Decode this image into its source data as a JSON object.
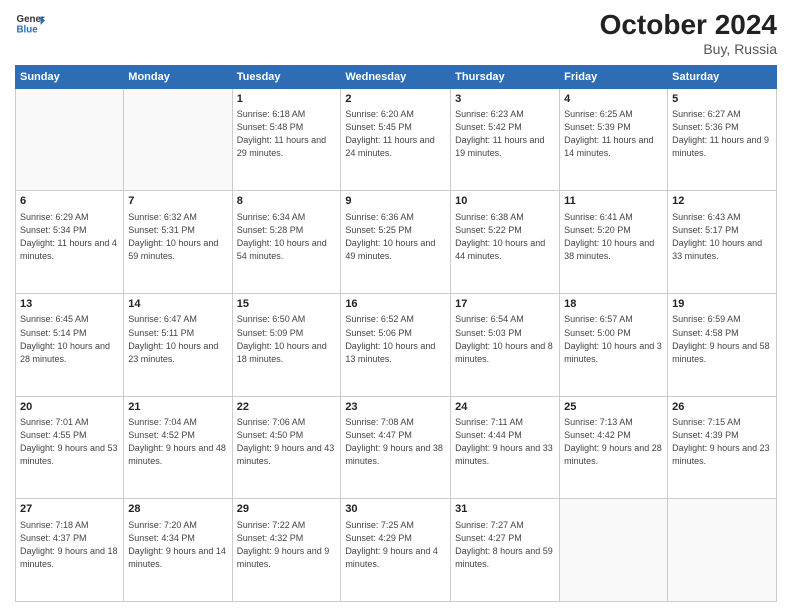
{
  "logo": {
    "line1": "General",
    "line2": "Blue"
  },
  "title": "October 2024",
  "location": "Buy, Russia",
  "days_header": [
    "Sunday",
    "Monday",
    "Tuesday",
    "Wednesday",
    "Thursday",
    "Friday",
    "Saturday"
  ],
  "weeks": [
    [
      {
        "day": "",
        "content": ""
      },
      {
        "day": "",
        "content": ""
      },
      {
        "day": "1",
        "content": "Sunrise: 6:18 AM\nSunset: 5:48 PM\nDaylight: 11 hours\nand 29 minutes."
      },
      {
        "day": "2",
        "content": "Sunrise: 6:20 AM\nSunset: 5:45 PM\nDaylight: 11 hours\nand 24 minutes."
      },
      {
        "day": "3",
        "content": "Sunrise: 6:23 AM\nSunset: 5:42 PM\nDaylight: 11 hours\nand 19 minutes."
      },
      {
        "day": "4",
        "content": "Sunrise: 6:25 AM\nSunset: 5:39 PM\nDaylight: 11 hours\nand 14 minutes."
      },
      {
        "day": "5",
        "content": "Sunrise: 6:27 AM\nSunset: 5:36 PM\nDaylight: 11 hours\nand 9 minutes."
      }
    ],
    [
      {
        "day": "6",
        "content": "Sunrise: 6:29 AM\nSunset: 5:34 PM\nDaylight: 11 hours\nand 4 minutes."
      },
      {
        "day": "7",
        "content": "Sunrise: 6:32 AM\nSunset: 5:31 PM\nDaylight: 10 hours\nand 59 minutes."
      },
      {
        "day": "8",
        "content": "Sunrise: 6:34 AM\nSunset: 5:28 PM\nDaylight: 10 hours\nand 54 minutes."
      },
      {
        "day": "9",
        "content": "Sunrise: 6:36 AM\nSunset: 5:25 PM\nDaylight: 10 hours\nand 49 minutes."
      },
      {
        "day": "10",
        "content": "Sunrise: 6:38 AM\nSunset: 5:22 PM\nDaylight: 10 hours\nand 44 minutes."
      },
      {
        "day": "11",
        "content": "Sunrise: 6:41 AM\nSunset: 5:20 PM\nDaylight: 10 hours\nand 38 minutes."
      },
      {
        "day": "12",
        "content": "Sunrise: 6:43 AM\nSunset: 5:17 PM\nDaylight: 10 hours\nand 33 minutes."
      }
    ],
    [
      {
        "day": "13",
        "content": "Sunrise: 6:45 AM\nSunset: 5:14 PM\nDaylight: 10 hours\nand 28 minutes."
      },
      {
        "day": "14",
        "content": "Sunrise: 6:47 AM\nSunset: 5:11 PM\nDaylight: 10 hours\nand 23 minutes."
      },
      {
        "day": "15",
        "content": "Sunrise: 6:50 AM\nSunset: 5:09 PM\nDaylight: 10 hours\nand 18 minutes."
      },
      {
        "day": "16",
        "content": "Sunrise: 6:52 AM\nSunset: 5:06 PM\nDaylight: 10 hours\nand 13 minutes."
      },
      {
        "day": "17",
        "content": "Sunrise: 6:54 AM\nSunset: 5:03 PM\nDaylight: 10 hours\nand 8 minutes."
      },
      {
        "day": "18",
        "content": "Sunrise: 6:57 AM\nSunset: 5:00 PM\nDaylight: 10 hours\nand 3 minutes."
      },
      {
        "day": "19",
        "content": "Sunrise: 6:59 AM\nSunset: 4:58 PM\nDaylight: 9 hours\nand 58 minutes."
      }
    ],
    [
      {
        "day": "20",
        "content": "Sunrise: 7:01 AM\nSunset: 4:55 PM\nDaylight: 9 hours\nand 53 minutes."
      },
      {
        "day": "21",
        "content": "Sunrise: 7:04 AM\nSunset: 4:52 PM\nDaylight: 9 hours\nand 48 minutes."
      },
      {
        "day": "22",
        "content": "Sunrise: 7:06 AM\nSunset: 4:50 PM\nDaylight: 9 hours\nand 43 minutes."
      },
      {
        "day": "23",
        "content": "Sunrise: 7:08 AM\nSunset: 4:47 PM\nDaylight: 9 hours\nand 38 minutes."
      },
      {
        "day": "24",
        "content": "Sunrise: 7:11 AM\nSunset: 4:44 PM\nDaylight: 9 hours\nand 33 minutes."
      },
      {
        "day": "25",
        "content": "Sunrise: 7:13 AM\nSunset: 4:42 PM\nDaylight: 9 hours\nand 28 minutes."
      },
      {
        "day": "26",
        "content": "Sunrise: 7:15 AM\nSunset: 4:39 PM\nDaylight: 9 hours\nand 23 minutes."
      }
    ],
    [
      {
        "day": "27",
        "content": "Sunrise: 7:18 AM\nSunset: 4:37 PM\nDaylight: 9 hours\nand 18 minutes."
      },
      {
        "day": "28",
        "content": "Sunrise: 7:20 AM\nSunset: 4:34 PM\nDaylight: 9 hours\nand 14 minutes."
      },
      {
        "day": "29",
        "content": "Sunrise: 7:22 AM\nSunset: 4:32 PM\nDaylight: 9 hours\nand 9 minutes."
      },
      {
        "day": "30",
        "content": "Sunrise: 7:25 AM\nSunset: 4:29 PM\nDaylight: 9 hours\nand 4 minutes."
      },
      {
        "day": "31",
        "content": "Sunrise: 7:27 AM\nSunset: 4:27 PM\nDaylight: 8 hours\nand 59 minutes."
      },
      {
        "day": "",
        "content": ""
      },
      {
        "day": "",
        "content": ""
      }
    ]
  ]
}
